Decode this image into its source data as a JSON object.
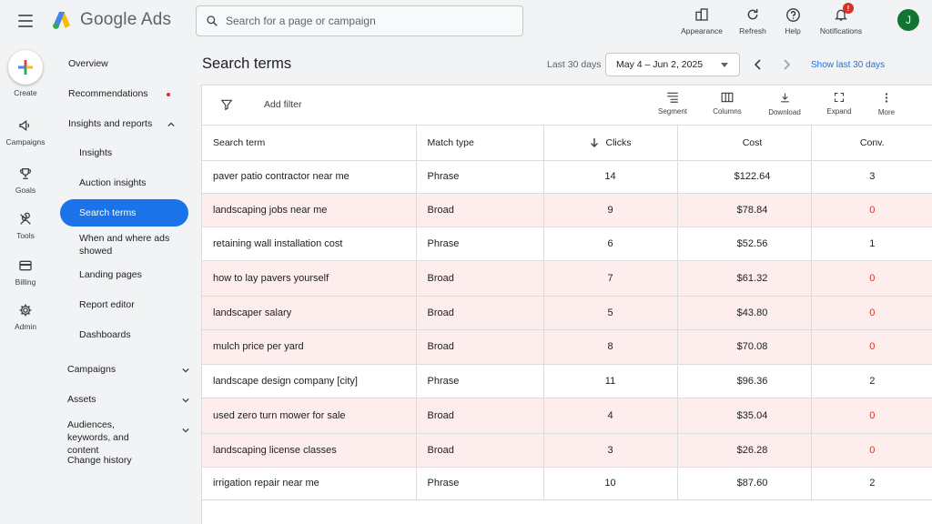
{
  "app": {
    "name": "Google Ads",
    "search_placeholder": "Search for a page or campaign",
    "avatar_initial": "J",
    "notification_badge": "!"
  },
  "top_tools": [
    {
      "label": "Appearance",
      "icon": "appearance-icon"
    },
    {
      "label": "Refresh",
      "icon": "refresh-icon"
    },
    {
      "label": "Help",
      "icon": "help-icon"
    },
    {
      "label": "Notifications",
      "icon": "bell-icon"
    }
  ],
  "rail": {
    "create": "Create",
    "items": [
      {
        "label": "Campaigns",
        "icon": "megaphone-icon"
      },
      {
        "label": "Goals",
        "icon": "trophy-icon"
      },
      {
        "label": "Tools",
        "icon": "tools-icon"
      },
      {
        "label": "Billing",
        "icon": "credit-card-icon"
      },
      {
        "label": "Admin",
        "icon": "gear-icon"
      }
    ]
  },
  "sidenav": {
    "overview": "Overview",
    "recommendations": "Recommendations",
    "insights_reports": "Insights and reports",
    "insights": "Insights",
    "auction_insights": "Auction insights",
    "search_terms": "Search terms",
    "when_where": "When and where ads showed",
    "landing_pages": "Landing pages",
    "report_editor": "Report editor",
    "dashboards": "Dashboards",
    "campaigns": "Campaigns",
    "assets": "Assets",
    "audiences": "Audiences, keywords, and content",
    "change_history": "Change history"
  },
  "header": {
    "title": "Search terms",
    "date_label": "Last 30 days",
    "date_range": "May 4 – Jun 2, 2025",
    "show_last": "Show last 30 days"
  },
  "toolbar": {
    "add_filter": "Add filter",
    "buttons": [
      {
        "label": "Segment",
        "icon": "segment-icon"
      },
      {
        "label": "Columns",
        "icon": "columns-icon"
      },
      {
        "label": "Download",
        "icon": "download-icon"
      },
      {
        "label": "Expand",
        "icon": "expand-icon"
      },
      {
        "label": "More",
        "icon": "more-vert-icon"
      }
    ]
  },
  "table": {
    "headers": {
      "term": "Search term",
      "match": "Match type",
      "clicks": "Clicks",
      "cost": "Cost",
      "conv": "Conv."
    },
    "rows": [
      {
        "term": "paver patio contractor near me",
        "match": "Phrase",
        "clicks": "14",
        "cost": "$122.64",
        "conv": "3"
      },
      {
        "term": "landscaping jobs near me",
        "match": "Broad",
        "clicks": "9",
        "cost": "$78.84",
        "conv": "0"
      },
      {
        "term": "retaining wall installation cost",
        "match": "Phrase",
        "clicks": "6",
        "cost": "$52.56",
        "conv": "1"
      },
      {
        "term": "how to lay pavers yourself",
        "match": "Broad",
        "clicks": "7",
        "cost": "$61.32",
        "conv": "0"
      },
      {
        "term": "landscaper salary",
        "match": "Broad",
        "clicks": "5",
        "cost": "$43.80",
        "conv": "0"
      },
      {
        "term": "mulch price per yard",
        "match": "Broad",
        "clicks": "8",
        "cost": "$70.08",
        "conv": "0"
      },
      {
        "term": "landscape design company [city]",
        "match": "Phrase",
        "clicks": "11",
        "cost": "$96.36",
        "conv": "2"
      },
      {
        "term": "used zero turn mower for sale",
        "match": "Broad",
        "clicks": "4",
        "cost": "$35.04",
        "conv": "0"
      },
      {
        "term": "landscaping license classes",
        "match": "Broad",
        "clicks": "3",
        "cost": "$26.28",
        "conv": "0"
      },
      {
        "term": "irrigation repair near me",
        "match": "Phrase",
        "clicks": "10",
        "cost": "$87.60",
        "conv": "2"
      }
    ]
  },
  "colors": {
    "accent": "#1a73e8",
    "zero_conv": "#d93025",
    "zero_row_bg": "#fdeeed",
    "avatar": "#137333"
  }
}
